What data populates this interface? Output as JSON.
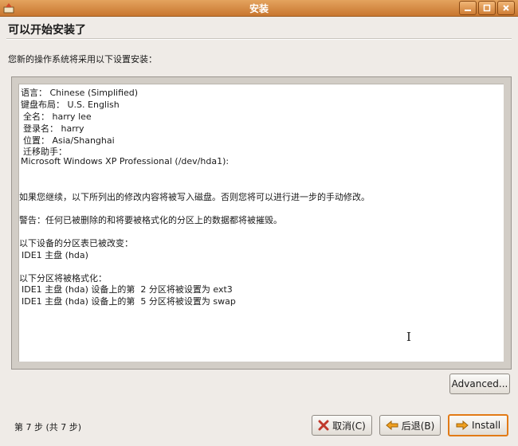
{
  "window": {
    "title": "安装"
  },
  "page": {
    "title": "可以开始安装了",
    "intro": "您新的操作系统将采用以下设置安装："
  },
  "summary": {
    "language": "语言： Chinese (Simplified)",
    "keyboard": "键盘布局： U.S. English",
    "fullname": "全名： harry lee",
    "login": "登录名： harry",
    "location": "位置： Asia/Shanghai",
    "migration": "迁移助手：",
    "migration_source": "Microsoft Windows XP Professional (/dev/hda1):",
    "continue_note": "如果您继续，以下所列出的修改内容将被写入磁盘。否则您将可以进行进一步的手动修改。",
    "warning": "警告：任何已被删除的和将要被格式化的分区上的数据都将被摧毁。",
    "partition_table_heading": "以下设备的分区表已被改变：",
    "partition_table_device": "IDE1 主盘 (hda)",
    "format_heading": "以下分区将被格式化：",
    "format_items": [
      "IDE1 主盘 (hda) 设备上的第  2 分区将被设置为 ext3",
      "IDE1 主盘 (hda) 设备上的第  5 分区将被设置为 swap"
    ]
  },
  "buttons": {
    "advanced": "Advanced...",
    "cancel": "取消(C)",
    "back": "后退(B)",
    "install": "Install"
  },
  "footer": {
    "step": "第 7 步 (共 7 步)"
  },
  "colors": {
    "titlebar": "#d98a43",
    "install_border": "#e27a16",
    "cancel_icon": "#c0392b",
    "arrow": "#f0a020"
  }
}
